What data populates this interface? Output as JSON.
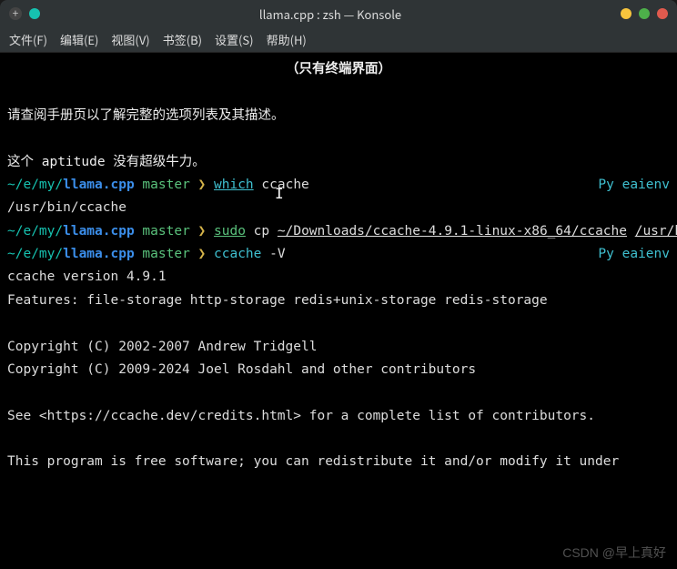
{
  "window": {
    "title": "llama.cpp : zsh — Konsole",
    "tabdot_color": "#16c2b0",
    "btn_min": "#f7c43d",
    "btn_max": "#4db04a",
    "btn_close": "#e05a4e"
  },
  "menu": {
    "file": "文件(F)",
    "edit": "编辑(E)",
    "view": "视图(V)",
    "bookmarks": "书签(B)",
    "settings": "设置(S)",
    "help": "帮助(H)"
  },
  "term": {
    "heading": "（只有终端界面）",
    "line_a": "请查阅手册页以了解完整的选项列表及其描述。",
    "line_b": "这个 aptitude 没有超级牛力。",
    "prompt": {
      "path_prefix": "~/e/my/",
      "repo": "llama.cpp",
      "branch": "master",
      "marker": "❯",
      "venv": "Py eaienv"
    },
    "cmd1": {
      "word1": "which",
      "arg": "ccache"
    },
    "out1": "/usr/bin/ccache",
    "cmd2": {
      "word1": "sudo",
      "word2": "cp",
      "arg1": "~/Downloads/ccache-4.9.1-linux-x86_64/ccache",
      "arg2": "/usr/bin/ccache"
    },
    "cmd3": {
      "word1": "ccache",
      "arg": "-V"
    },
    "out3_line1": "ccache version 4.9.1",
    "out3_line2": "Features: file-storage http-storage redis+unix-storage redis-storage",
    "out3_line3": "Copyright (C) 2002-2007 Andrew Tridgell",
    "out3_line4": "Copyright (C) 2009-2024 Joel Rosdahl and other contributors",
    "out3_line5": "See <https://ccache.dev/credits.html> for a complete list of contributors.",
    "out3_line6": "This program is free software; you can redistribute it and/or modify it under"
  },
  "watermark": "CSDN @早上真好"
}
